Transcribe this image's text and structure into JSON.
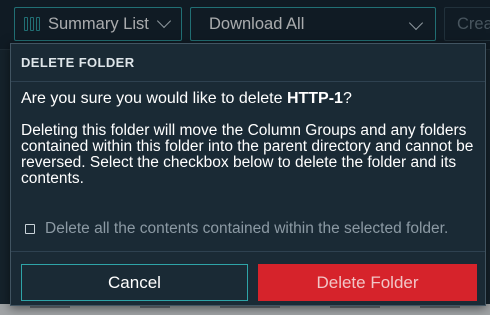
{
  "toolbar": {
    "summary_label": "Summary List",
    "download_label": "Download All",
    "create_label": "Crea"
  },
  "dialog": {
    "title": "DELETE FOLDER",
    "question_prefix": "Are you sure you would like to delete ",
    "folder_name": "HTTP-1",
    "question_suffix": "?",
    "warning": "Deleting this folder will move the Column Groups and any folders contained within this folder into the parent directory and cannot be reversed. Select the checkbox below to delete the folder and its contents.",
    "checkbox_label": "Delete all the contents contained within the selected folder.",
    "checkbox_checked": false,
    "cancel_label": "Cancel",
    "delete_label": "Delete Folder"
  },
  "colors": {
    "accent": "#2ea4a8",
    "danger": "#d6232b",
    "dialog_bg": "#1a2a35"
  },
  "icons": {
    "summary": "columns-icon",
    "dropdown": "chevron-down-icon",
    "checkbox": "checkbox-icon"
  }
}
